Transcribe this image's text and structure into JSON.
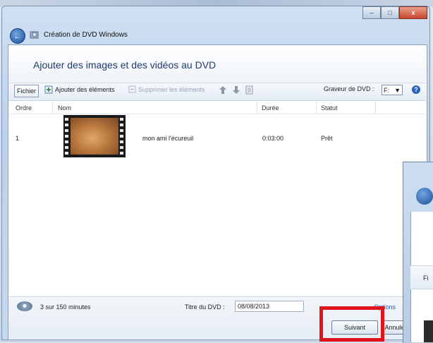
{
  "window": {
    "title": "Création de DVD Windows",
    "min_label": "–",
    "max_label": "□",
    "close_label": "x"
  },
  "header": {
    "title": "Ajouter des images et des vidéos au DVD"
  },
  "toolbar": {
    "file_label": "Fichier",
    "add_label": "Ajouter des éléments",
    "remove_label": "Supprimer les éléments",
    "burner_label": "Graveur de DVD :",
    "burner_value": "F:",
    "help_label": "?"
  },
  "columns": [
    "Ordre",
    "Nom",
    "Durée",
    "Statut"
  ],
  "rows": [
    {
      "order": "1",
      "name": "mon ami l'écureuil",
      "duration": "0:03:00",
      "status": "Prêt"
    }
  ],
  "footer": {
    "usage": "3 sur 150 minutes",
    "dvd_title_label": "Titre du DVD :",
    "dvd_title_value": "08/08/2013",
    "options_label": "Options",
    "next_label": "Suivant",
    "cancel_label": "Annuler"
  },
  "second_window": {
    "partial_text": "Fi"
  },
  "colors": {
    "highlight": "#e0141b",
    "header_text": "#1f3b6b"
  }
}
